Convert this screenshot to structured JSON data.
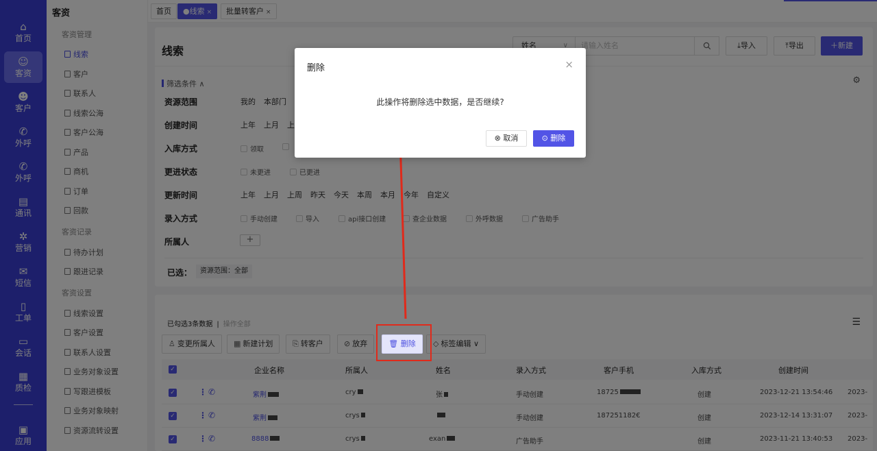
{
  "rail": [
    {
      "icon": "home-icon",
      "glyph": "⌂",
      "label": "首页"
    },
    {
      "icon": "users-icon",
      "glyph": "☺",
      "label": "客资"
    },
    {
      "icon": "person-icon",
      "glyph": "☻",
      "label": "客户"
    },
    {
      "icon": "phone-call-icon",
      "glyph": "✆",
      "label": "外呼"
    },
    {
      "icon": "phone-call-icon",
      "glyph": "✆",
      "label": "外呼"
    },
    {
      "icon": "contacts-icon",
      "glyph": "▤",
      "label": "通讯"
    },
    {
      "icon": "marketing-icon",
      "glyph": "✲",
      "label": "营销"
    },
    {
      "icon": "message-icon",
      "glyph": "✉",
      "label": "短信"
    },
    {
      "icon": "clipboard-icon",
      "glyph": "▯",
      "label": "工单"
    },
    {
      "icon": "chat-icon",
      "glyph": "▭",
      "label": "会话"
    },
    {
      "icon": "calendar-icon",
      "glyph": "▦",
      "label": "质检"
    },
    {
      "icon": "app-icon",
      "glyph": "▣",
      "label": "应用"
    }
  ],
  "menu": {
    "title": "客资",
    "groups": [
      {
        "label": "客资管理",
        "items": [
          "线索",
          "客户",
          "联系人",
          "线索公海",
          "客户公海",
          "产品",
          "商机",
          "订单",
          "回款"
        ]
      },
      {
        "label": "客资记录",
        "items": [
          "待办计划",
          "跟进记录"
        ]
      },
      {
        "label": "客资设置",
        "items": [
          "线索设置",
          "客户设置",
          "联系人设置",
          "业务对象设置",
          "写跟进模板",
          "业务对象映射",
          "资源流转设置"
        ]
      }
    ]
  },
  "tabs": [
    {
      "label": "首页"
    },
    {
      "label": "线索",
      "close": "×"
    },
    {
      "label": "批量转客户",
      "close": "×"
    }
  ],
  "page": {
    "title": "线索",
    "search_field": "姓名",
    "search_placeholder": "请输入姓名",
    "import_label": "导入",
    "export_label": "导出",
    "new_label": "新建"
  },
  "filters": {
    "toggle_label": "筛选条件",
    "resource_scope": {
      "label": "资源范围",
      "options": [
        "我的",
        "本部门"
      ]
    },
    "create_time": {
      "label": "创建时间",
      "options": [
        "上年",
        "上月",
        "上"
      ]
    },
    "storage_method": {
      "label": "入库方式",
      "options": [
        "领取",
        ""
      ]
    },
    "follow_status": {
      "label": "更进状态",
      "options": [
        "未更进",
        "已更进"
      ]
    },
    "update_time": {
      "label": "更新时间",
      "options": [
        "上年",
        "上月",
        "上周",
        "昨天",
        "今天",
        "本周",
        "本月",
        "今年",
        "自定义"
      ]
    },
    "entry_method": {
      "label": "录入方式",
      "options": [
        "手动创建",
        "导入",
        "api接口创建",
        "查企业数据",
        "外呼数据",
        "广告助手"
      ]
    },
    "owner": {
      "label": "所属人",
      "add": "+"
    },
    "selected_label": "已选：",
    "selected_tag": "资源范围：全部"
  },
  "list": {
    "selected_info": "已勾选3条数据",
    "separator": "|",
    "op_all": "操作全部",
    "actions": [
      {
        "icon": "user-icon",
        "glyph": "♙",
        "label": "变更所属人"
      },
      {
        "icon": "calendar-icon",
        "glyph": "▦",
        "label": "新建计划"
      },
      {
        "icon": "convert-icon",
        "glyph": "⎘",
        "label": "转客户"
      },
      {
        "icon": "discard-icon",
        "glyph": "⊘",
        "label": "放弃"
      },
      {
        "icon": "trash-icon",
        "glyph": "🗑",
        "label": "删除"
      },
      {
        "icon": "tag-icon",
        "glyph": "◇",
        "label": "标签编辑"
      }
    ],
    "columns": [
      "企业名称",
      "所属人",
      "姓名",
      "录入方式",
      "客户手机",
      "入库方式",
      "创建时间"
    ],
    "rows": [
      {
        "company": "紫荆",
        "owner": "cry",
        "name": "张",
        "entry": "手动创建",
        "phone": "18725",
        "storage": "创建",
        "created": "2023-12-21 13:54:46",
        "extra": "2023-"
      },
      {
        "company": "紫荆",
        "owner": "crys",
        "name": "",
        "entry": "手动创建",
        "phone": "187251182€",
        "storage": "创建",
        "created": "2023-12-14 13:31:07",
        "extra": "2023-"
      },
      {
        "company": "8888",
        "owner": "crys",
        "name": "exan",
        "entry": "广告助手",
        "phone": "",
        "storage": "创建",
        "created": "2023-11-21 13:40:53",
        "extra": "2023-"
      }
    ]
  },
  "modal": {
    "title": "删除",
    "close": "×",
    "message": "此操作将删除选中数据，是否继续?",
    "cancel_label": "取消",
    "confirm_label": "删除"
  },
  "annotation_color": "#e02a1b",
  "accent": "#5254e6"
}
